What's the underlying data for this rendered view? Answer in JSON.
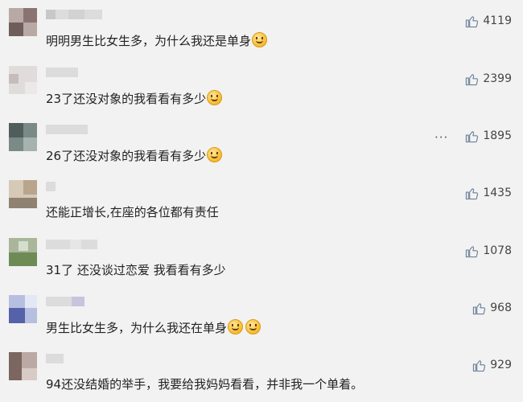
{
  "comments": [
    {
      "text": "明明男生比女生多，为什么我还是单身",
      "emoji": "crying-emoji",
      "likes": "4119"
    },
    {
      "text": "23了还没对象的我看看有多少",
      "emoji": "laugh-cry-emoji",
      "likes": "2399"
    },
    {
      "text": "26了还没对象的我看看有多少",
      "emoji": "laugh-cry-emoji",
      "likes": "1895",
      "menu": "···"
    },
    {
      "text": "还能正增长,在座的各位都有责任",
      "likes": "1435"
    },
    {
      "text": "31了 还没谈过恋爱 我看看有多少",
      "likes": "1078"
    },
    {
      "text": "男生比女生多，为什么我还在单身",
      "emoji": "smile-emoji",
      "emoji2": "smile-emoji",
      "likes": "968"
    },
    {
      "text": "94还没结婚的举手，我要给我妈妈看看，并非我一个单着。",
      "likes": "929"
    }
  ],
  "colors": {
    "background": "#f2f2f2",
    "text": "#222222",
    "like_icon": "#6b7f9a"
  }
}
